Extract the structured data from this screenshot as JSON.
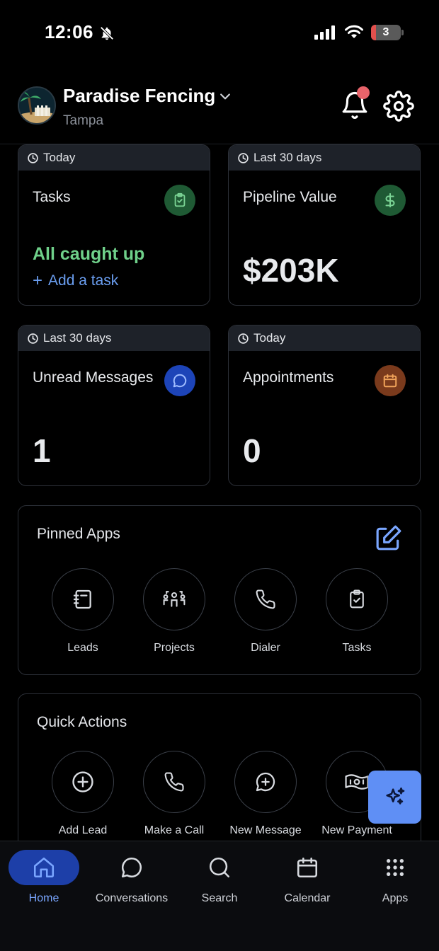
{
  "status_bar": {
    "time": "12:06",
    "battery": "3"
  },
  "header": {
    "company": "Paradise Fencing",
    "location": "Tampa"
  },
  "cards": [
    {
      "period": "Today",
      "title": "Tasks",
      "status": "All caught up",
      "action": "Add a task",
      "icon": "clipboard-check-icon",
      "icon_bg": "#1f5a34",
      "icon_color": "#7bd495"
    },
    {
      "period": "Last 30 days",
      "title": "Pipeline Value",
      "value": "$203K",
      "icon": "dollar-icon",
      "icon_bg": "#1f5a34",
      "icon_color": "#7bd495"
    },
    {
      "period": "Last 30 days",
      "title": "Unread Messages",
      "value": "1",
      "icon": "chat-bubble-icon",
      "icon_bg": "#1d44b8",
      "icon_color": "#9fbcff"
    },
    {
      "period": "Today",
      "title": "Appointments",
      "value": "0",
      "icon": "calendar-icon",
      "icon_bg": "#7a3a1c",
      "icon_color": "#f0a35a"
    }
  ],
  "pinned_apps": {
    "title": "Pinned Apps",
    "items": [
      {
        "label": "Leads",
        "icon": "notebook-icon"
      },
      {
        "label": "Projects",
        "icon": "team-icon"
      },
      {
        "label": "Dialer",
        "icon": "phone-icon"
      },
      {
        "label": "Tasks",
        "icon": "clipboard-check-icon"
      }
    ]
  },
  "quick_actions": {
    "title": "Quick Actions",
    "items": [
      {
        "label": "Add Lead",
        "icon": "plus-circle-icon"
      },
      {
        "label": "Make a Call",
        "icon": "phone-icon"
      },
      {
        "label": "New Message",
        "icon": "message-plus-icon"
      },
      {
        "label": "New Payment",
        "icon": "money-icon"
      }
    ]
  },
  "nav": [
    {
      "label": "Home",
      "icon": "home-icon",
      "active": true
    },
    {
      "label": "Conversations",
      "icon": "chat-bubble-icon",
      "active": false
    },
    {
      "label": "Search",
      "icon": "search-icon",
      "active": false
    },
    {
      "label": "Calendar",
      "icon": "calendar-icon",
      "active": false
    },
    {
      "label": "Apps",
      "icon": "grid-icon",
      "active": false
    }
  ],
  "colors": {
    "accent": "#5f8ff5",
    "active_nav": "#1d3fa8",
    "success": "#6fd08a",
    "link": "#6b9ff2",
    "notification": "#e8636a"
  }
}
